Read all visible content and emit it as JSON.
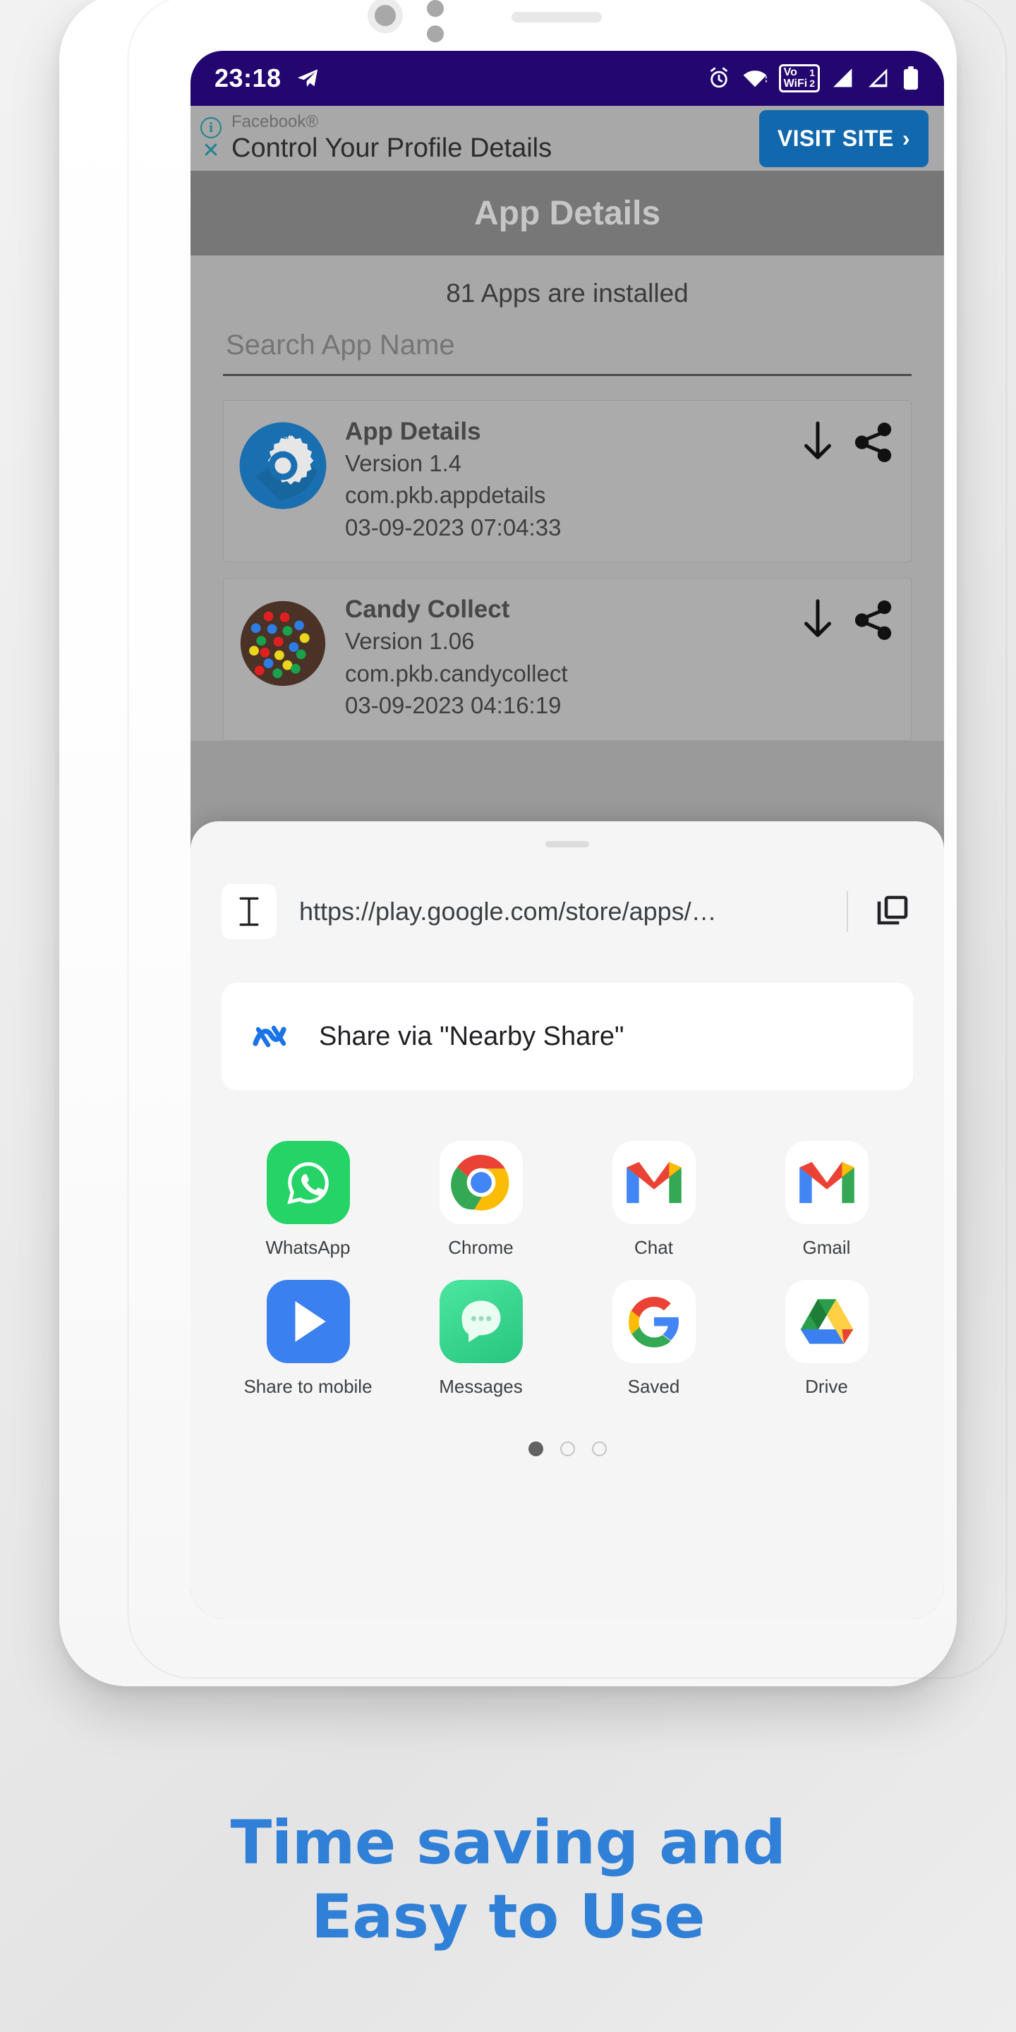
{
  "status_bar": {
    "time": "23:18",
    "telegram_icon": "telegram-icon",
    "alarm_icon": "alarm-icon",
    "wifi_icon": "wifi-icon",
    "vowifi_label": "Vo",
    "vowifi_label2": "WiFi",
    "sim1": "1",
    "sim2": "2",
    "signal1_icon": "signal-bars-icon",
    "signal2_icon": "signal-bars-icon",
    "battery_icon": "battery-icon",
    "background_color": "#230670"
  },
  "ad_banner": {
    "info_icon": "i",
    "close_icon": "✕",
    "brand": "Facebook®",
    "headline": "Control Your Profile Details",
    "cta_label": "VISIT SITE",
    "cta_chevron": "›",
    "cta_color": "#1268ad"
  },
  "app_bar": {
    "title": "App Details"
  },
  "main": {
    "installed_count": "81 Apps are installed",
    "search_placeholder": "Search App Name",
    "search_value": "",
    "apps": [
      {
        "name": "App Details",
        "version": "Version 1.4",
        "package": "com.pkb.appdetails",
        "timestamp": "03-09-2023 07:04:33",
        "icon": "gear-app-icon",
        "download_icon": "download-arrow-icon",
        "share_icon": "share-icon"
      },
      {
        "name": "Candy Collect",
        "version": "Version 1.06",
        "package": "com.pkb.candycollect",
        "timestamp": "03-09-2023 04:16:19",
        "icon": "candy-app-icon",
        "download_icon": "download-arrow-icon",
        "share_icon": "share-icon"
      }
    ]
  },
  "share_sheet": {
    "drag_handle": "drag-handle",
    "text_chip_icon": "text-cursor-icon",
    "url": "https://play.google.com/store/apps/…",
    "copy_icon": "copy-icon",
    "nearby": {
      "icon": "nearby-share-icon",
      "label": "Share via \"Nearby Share\""
    },
    "targets": [
      {
        "label": "WhatsApp",
        "icon": "whatsapp-icon"
      },
      {
        "label": "Chrome",
        "icon": "chrome-icon"
      },
      {
        "label": "Chat",
        "icon": "google-chat-icon"
      },
      {
        "label": "Gmail",
        "icon": "gmail-icon"
      },
      {
        "label": "Share to mobile",
        "icon": "share-to-mobile-icon"
      },
      {
        "label": "Messages",
        "icon": "messages-icon"
      },
      {
        "label": "Saved",
        "icon": "google-saved-icon"
      },
      {
        "label": "Drive",
        "icon": "google-drive-icon"
      }
    ],
    "page_dots": {
      "total": 3,
      "active_index": 0
    }
  },
  "tagline": {
    "line1": "Time saving and",
    "line2": "Easy to Use",
    "color": "#3080d8"
  }
}
